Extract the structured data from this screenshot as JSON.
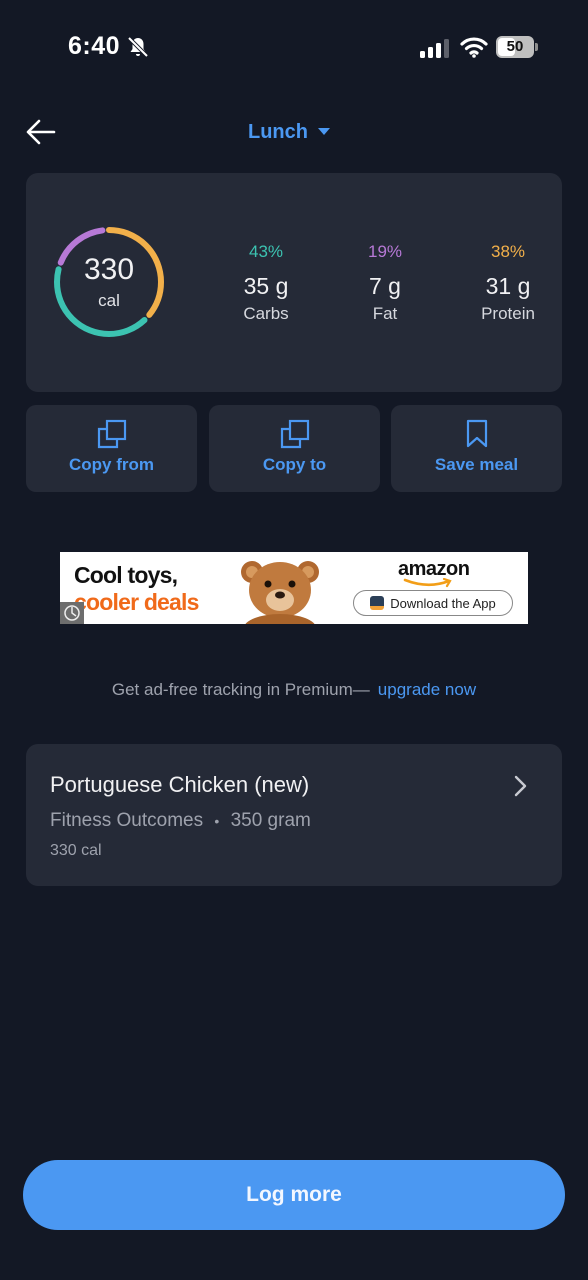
{
  "status_bar": {
    "time": "6:40",
    "battery": "50",
    "battery_level": 0.5,
    "icons": [
      "bell-slash-icon",
      "signal-icon",
      "wifi-icon",
      "battery-icon"
    ]
  },
  "header": {
    "back_icon": "arrow-left-icon",
    "meal": "Lunch",
    "dropdown_icon": "caret-down-icon"
  },
  "summary": {
    "calories": "330",
    "calories_unit": "cal",
    "ring_colors": {
      "carbs": "#3cc3b1",
      "fat": "#b779d6",
      "protein": "#f2b04a"
    },
    "ring_fractions": {
      "carbs": 0.43,
      "fat": 0.19,
      "protein": 0.38
    },
    "macros": [
      {
        "pct": "43%",
        "grams": "35 g",
        "name": "Carbs",
        "color": "#3cc3b1"
      },
      {
        "pct": "19%",
        "grams": "7 g",
        "name": "Fat",
        "color": "#b779d6"
      },
      {
        "pct": "38%",
        "grams": "31 g",
        "name": "Protein",
        "color": "#f2b04a"
      }
    ]
  },
  "actions": [
    {
      "label": "Copy from",
      "icon": "copy-icon"
    },
    {
      "label": "Copy to",
      "icon": "copy-icon"
    },
    {
      "label": "Save meal",
      "icon": "bookmark-icon"
    }
  ],
  "ad": {
    "headline_line1": "Cool toys,",
    "headline_line2": "cooler deals",
    "brand": "amazon",
    "cta": "Download the App"
  },
  "premium": {
    "text": "Get ad-free tracking in Premium—",
    "link": "upgrade now"
  },
  "food_item": {
    "name": "Portuguese Chicken (new)",
    "brand": "Fitness Outcomes",
    "separator": "•",
    "serving": "350 gram",
    "calories": "330 cal"
  },
  "footer": {
    "log_more": "Log more"
  },
  "colors": {
    "background": "#131825",
    "card": "#252a37",
    "accent": "#4b98f2"
  }
}
